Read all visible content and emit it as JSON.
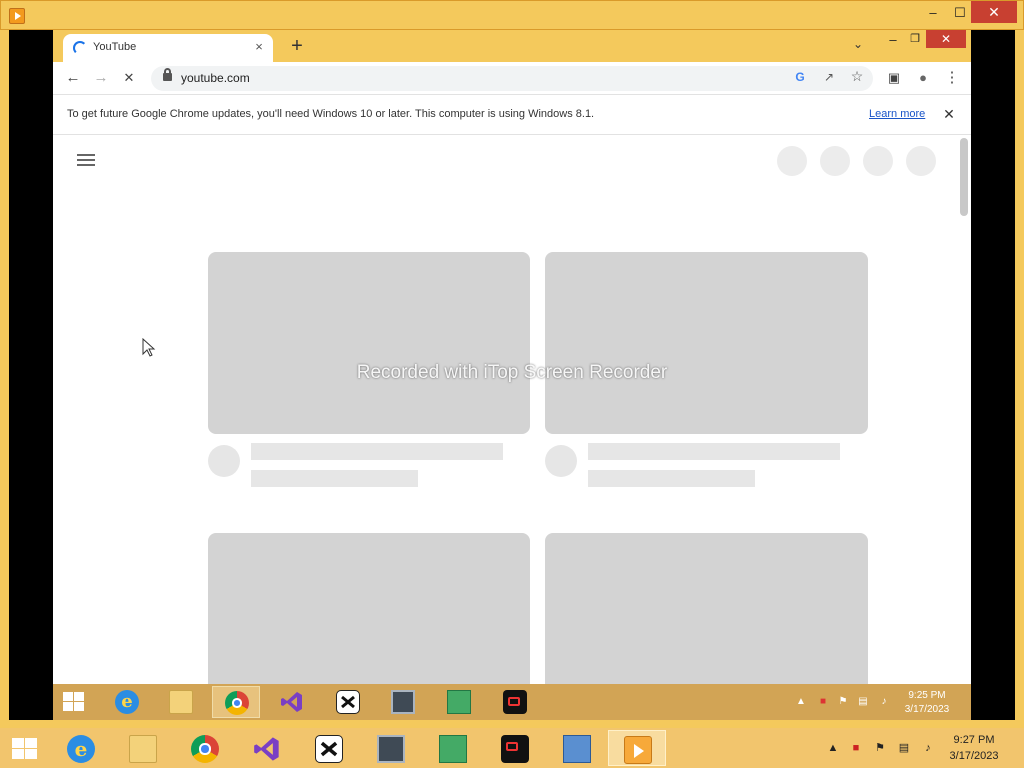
{
  "browser": {
    "tab_title": "YouTube",
    "tab_close": "×",
    "new_tab": "+",
    "tab_search": "⌄",
    "minimize": "–",
    "maximize": "❐",
    "close": "✕",
    "url": "youtube.com",
    "nav": {
      "back": "←",
      "forward": "→",
      "reload": "✕"
    },
    "omnibox_icons": {
      "google": "G",
      "share": "↗",
      "bookmark": "☆"
    },
    "toolbar_icons": {
      "side_panel": "▣",
      "profile": "●",
      "menu": "⋮"
    }
  },
  "infobar": {
    "message": "To get future Google Chrome updates, you'll need Windows 10 or later. This computer is using Windows 8.1.",
    "link": "Learn more",
    "close": "✕"
  },
  "overlay": {
    "watermark": "Recorded with iTop Screen Recorder"
  },
  "outer_window": {
    "minimize": "–",
    "maximize": "☐",
    "close": "✕"
  },
  "inner_taskbar": {
    "apps": [
      "internet-explorer",
      "file-explorer",
      "google-chrome",
      "visual-studio",
      "capcut",
      "system-monitor",
      "security-tool",
      "screen-recorder"
    ],
    "active_app": "google-chrome",
    "time": "9:25 PM",
    "date": "3/17/2023"
  },
  "outer_taskbar": {
    "apps": [
      "internet-explorer",
      "file-explorer",
      "google-chrome",
      "visual-studio",
      "capcut",
      "system-monitor",
      "security-tool",
      "screen-recorder",
      "this-pc",
      "media-player"
    ],
    "active_app": "media-player",
    "time": "9:27 PM",
    "date": "3/17/2023"
  },
  "colors": {
    "window_frame": "#f4c95c",
    "placeholder_thumb": "#d3d3d3",
    "placeholder_line": "#e6e6e6",
    "link": "#1a55c8",
    "close_button": "#c84031"
  }
}
